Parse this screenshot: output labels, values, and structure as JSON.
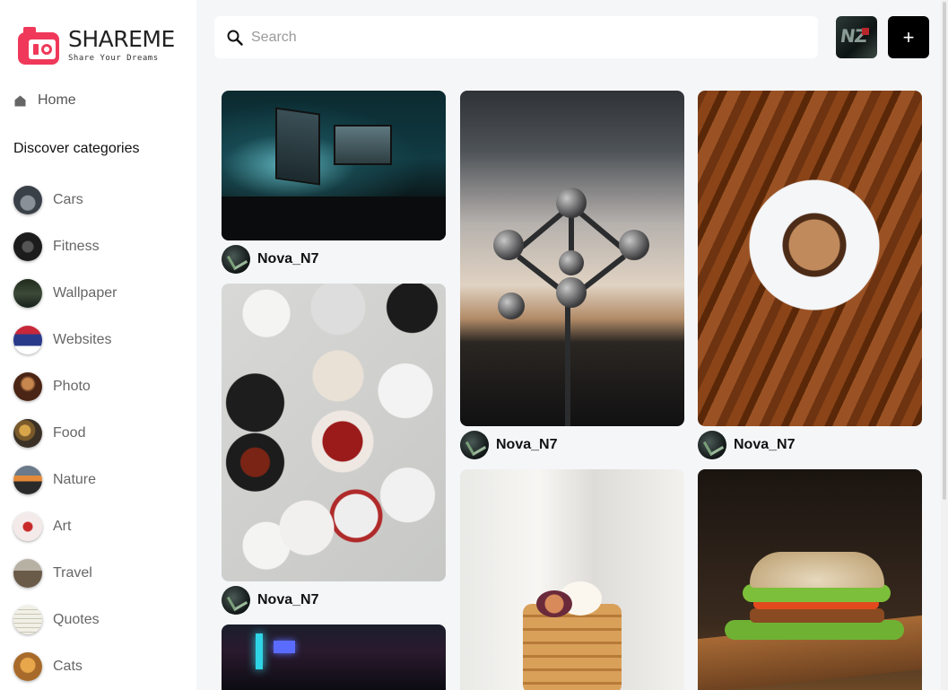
{
  "app": {
    "name": "SHAREME",
    "tagline": "Share Your Dreams",
    "accent_color": "#f0395a"
  },
  "sidebar": {
    "home_label": "Home",
    "discover_heading": "Discover categories",
    "categories": [
      {
        "label": "Cars",
        "thumb": "#5a6068"
      },
      {
        "label": "Fitness",
        "thumb": "#2a2a2a"
      },
      {
        "label": "Wallpaper",
        "thumb": "#2f3a2c"
      },
      {
        "label": "Websites",
        "thumb": "#2a3a7a"
      },
      {
        "label": "Photo",
        "thumb": "#6a3a22"
      },
      {
        "label": "Food",
        "thumb": "#8a6a3a"
      },
      {
        "label": "Nature",
        "thumb": "#c86a3a"
      },
      {
        "label": "Art",
        "thumb": "#e6c9c9"
      },
      {
        "label": "Travel",
        "thumb": "#7a6a58"
      },
      {
        "label": "Quotes",
        "thumb": "#ecebe2"
      },
      {
        "label": "Cats",
        "thumb": "#c8883a"
      }
    ]
  },
  "header": {
    "search_placeholder": "Search",
    "add_button_label": "+",
    "user_avatar_text": "NZ"
  },
  "pins": [
    {
      "user": "Nova_N7",
      "subject": "desk-setup"
    },
    {
      "user": "Nova_N7",
      "subject": "table-food"
    },
    {
      "user": "",
      "subject": "night-street"
    },
    {
      "user": "Nova_N7",
      "subject": "atomium"
    },
    {
      "user": "",
      "subject": "pancakes"
    },
    {
      "user": "Nova_N7",
      "subject": "coffee"
    },
    {
      "user": "",
      "subject": "burger"
    }
  ]
}
